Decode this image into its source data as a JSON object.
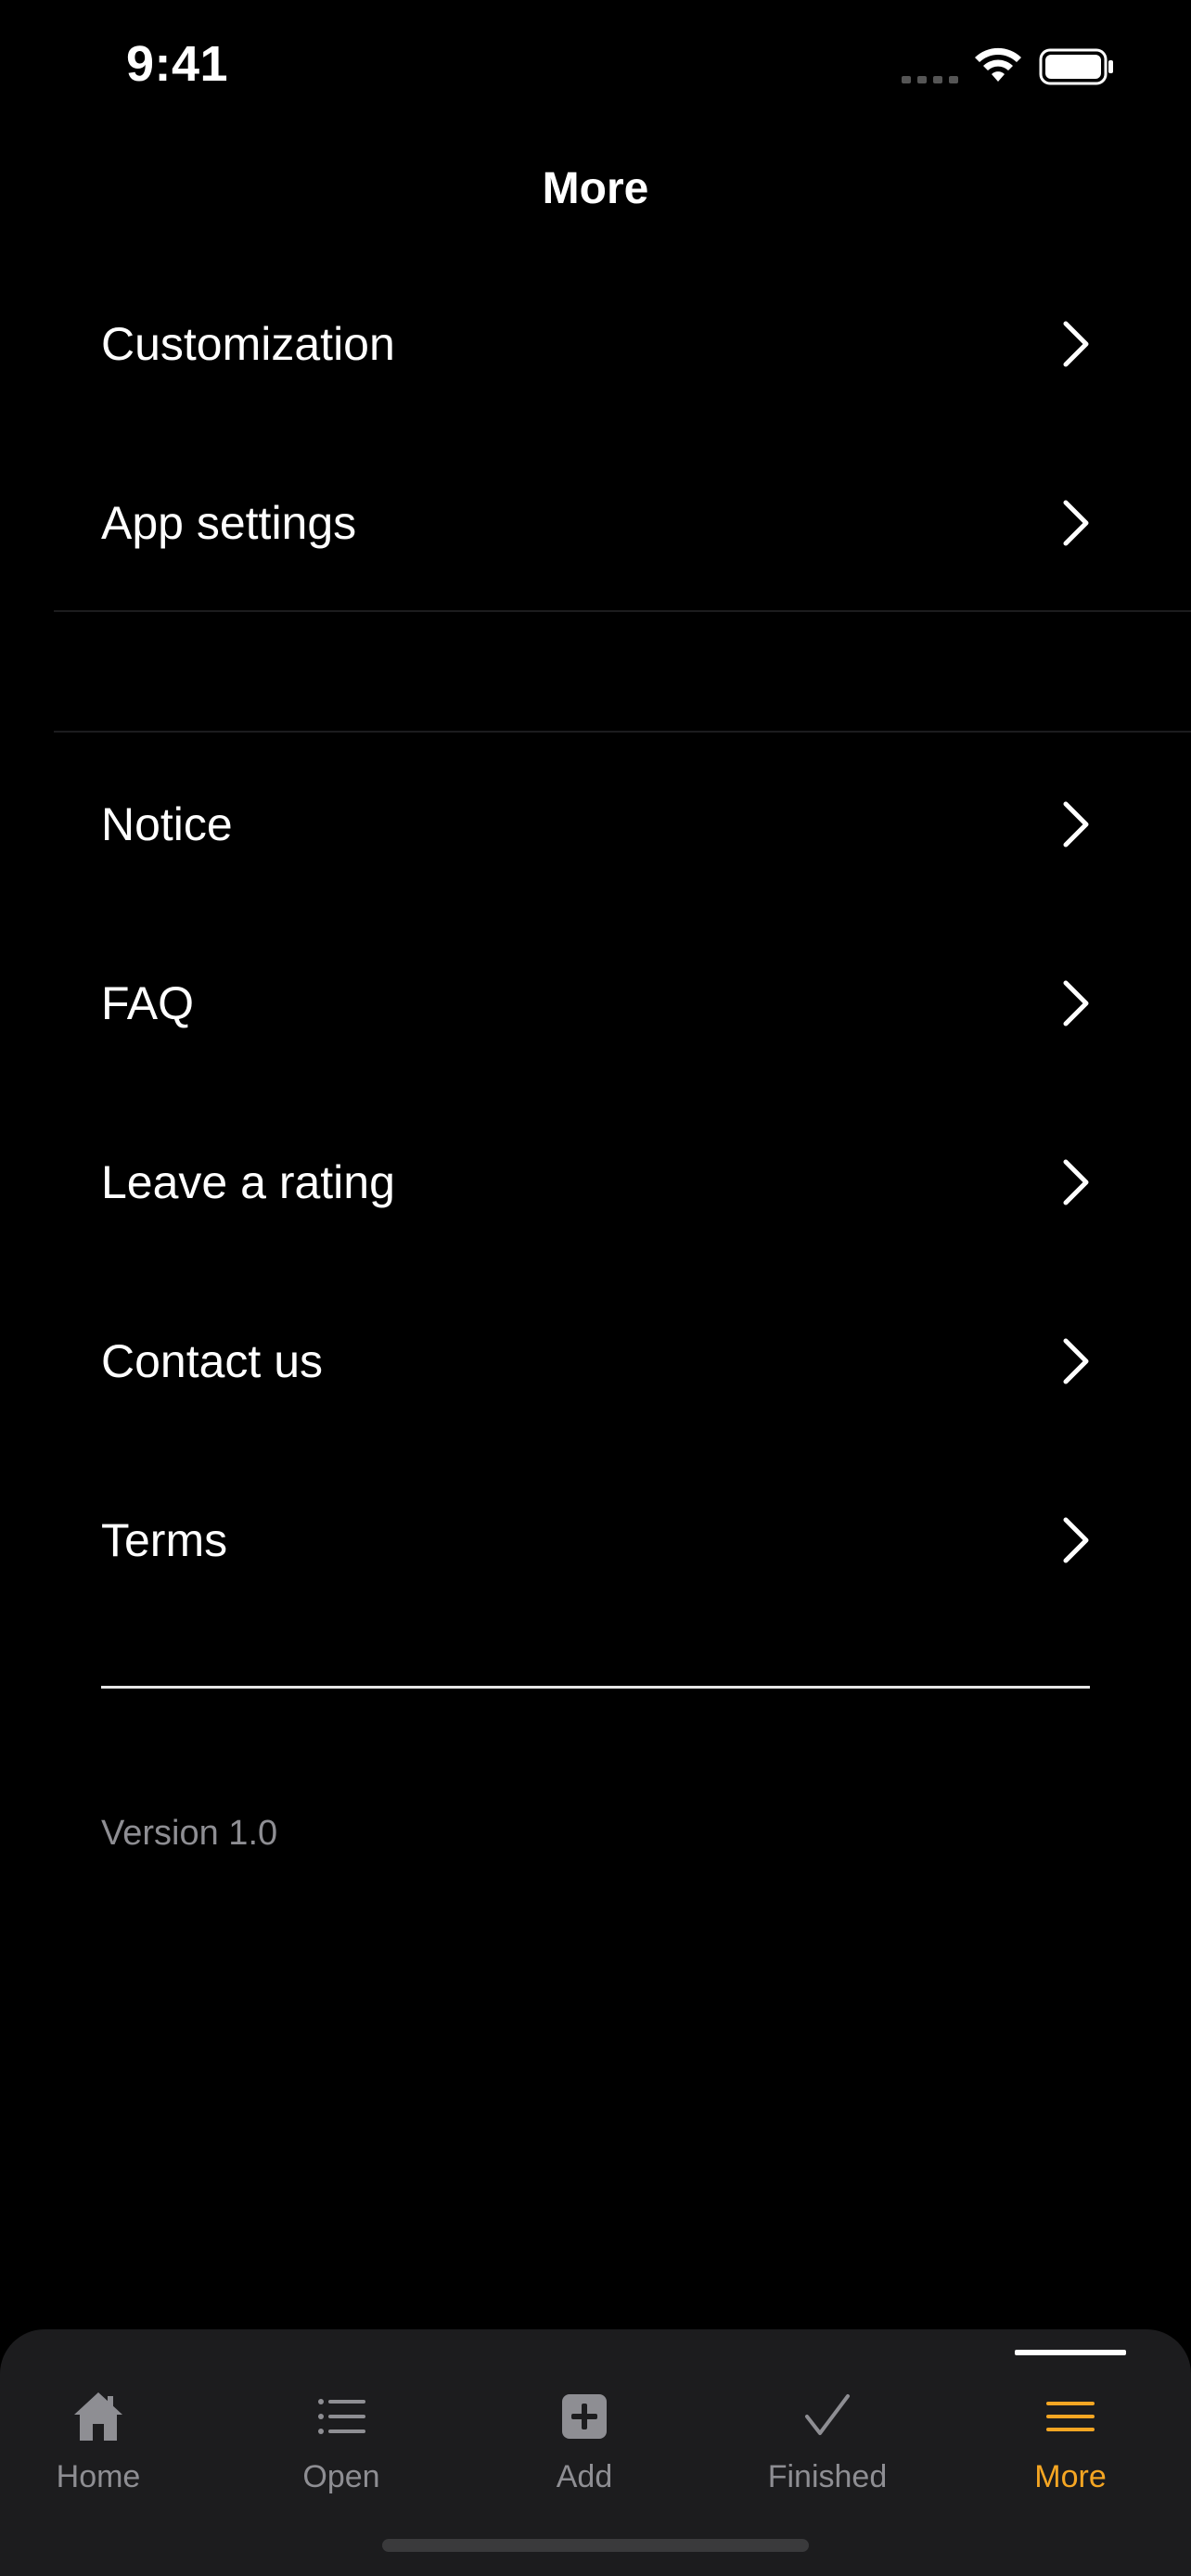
{
  "status_bar": {
    "time": "9:41"
  },
  "nav": {
    "title": "More"
  },
  "menu": {
    "group1": [
      {
        "label": "Customization",
        "icon": "chevron-right-icon"
      },
      {
        "label": "App settings",
        "icon": "chevron-right-icon"
      }
    ],
    "group2": [
      {
        "label": "Notice",
        "icon": "chevron-right-icon"
      },
      {
        "label": "FAQ",
        "icon": "chevron-right-icon"
      },
      {
        "label": "Leave a rating",
        "icon": "chevron-right-icon"
      },
      {
        "label": "Contact us",
        "icon": "chevron-right-icon"
      },
      {
        "label": "Terms",
        "icon": "chevron-right-icon"
      }
    ]
  },
  "footer": {
    "version": "Version 1.0"
  },
  "tab_bar": {
    "active": "More",
    "items": [
      {
        "label": "Home",
        "icon": "home-icon"
      },
      {
        "label": "Open",
        "icon": "list-icon"
      },
      {
        "label": "Add",
        "icon": "plus-square-icon"
      },
      {
        "label": "Finished",
        "icon": "checkmark-icon"
      },
      {
        "label": "More",
        "icon": "menu-icon"
      }
    ]
  },
  "colors": {
    "background": "#000000",
    "accent": "#F5A623",
    "tab_bar_background": "#1C1C1E",
    "secondary_text": "#8E8E93"
  }
}
